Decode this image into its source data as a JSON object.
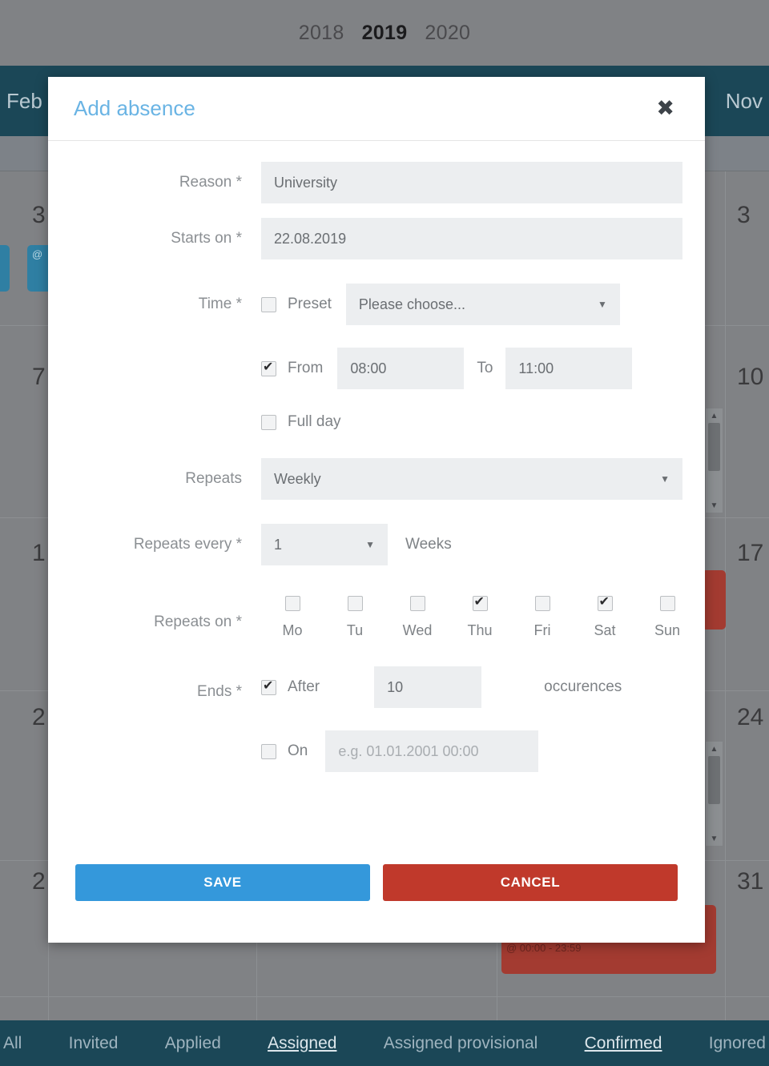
{
  "background": {
    "years": [
      {
        "label": "2018",
        "active": false
      },
      {
        "label": "2019",
        "active": true
      },
      {
        "label": "2020",
        "active": false
      }
    ],
    "month_nav": {
      "prev": "Feb",
      "next": "Nov"
    },
    "day_numbers_left": [
      "3",
      "7",
      "1",
      "2",
      "2"
    ],
    "day_numbers_right": [
      "3",
      "10",
      "17",
      "24",
      "31"
    ],
    "events": [
      {
        "label": "@",
        "color": "blue"
      },
      {
        "label": "@ 00:00 - 23:59",
        "color": "red"
      }
    ],
    "legend": [
      {
        "label": "All",
        "underline": false
      },
      {
        "label": "Invited",
        "underline": false
      },
      {
        "label": "Applied",
        "underline": false
      },
      {
        "label": "Assigned",
        "underline": true
      },
      {
        "label": "Assigned provisional",
        "underline": false
      },
      {
        "label": "Confirmed",
        "underline": true
      },
      {
        "label": "Ignored",
        "underline": false
      }
    ],
    "colors": {
      "navbar": "#1b4757",
      "overlay": "#808285",
      "blue_event": "#2f7fa3",
      "red_event": "#a33b31"
    }
  },
  "dialog": {
    "title": "Add absence",
    "close_label": "✖",
    "reason": {
      "label": "Reason *",
      "value": "University"
    },
    "starts_on": {
      "label": "Starts on *",
      "value": "22.08.2019"
    },
    "time": {
      "label": "Time *",
      "preset": {
        "checked": false,
        "label": "Preset",
        "value": "Please choose...",
        "caret": "▼"
      },
      "from": {
        "checked": true,
        "label": "From",
        "value": "08:00"
      },
      "to": {
        "label": "To",
        "value": "11:00"
      },
      "full_day": {
        "checked": false,
        "label": "Full day"
      }
    },
    "repeats": {
      "label": "Repeats",
      "value": "Weekly",
      "caret": "▼"
    },
    "repeats_every": {
      "label": "Repeats every *",
      "value": "1",
      "caret": "▼",
      "unit": "Weeks"
    },
    "repeats_on": {
      "label": "Repeats on *",
      "days": [
        {
          "label": "Mo",
          "checked": false
        },
        {
          "label": "Tu",
          "checked": false
        },
        {
          "label": "Wed",
          "checked": false
        },
        {
          "label": "Thu",
          "checked": true
        },
        {
          "label": "Fri",
          "checked": false
        },
        {
          "label": "Sat",
          "checked": true
        },
        {
          "label": "Sun",
          "checked": false
        }
      ]
    },
    "ends": {
      "label": "Ends *",
      "after": {
        "checked": true,
        "label": "After",
        "value": "10",
        "unit": "occurences"
      },
      "on": {
        "checked": false,
        "label": "On",
        "placeholder": "e.g. 01.01.2001 00:00",
        "value": ""
      }
    },
    "buttons": {
      "save": "SAVE",
      "cancel": "CANCEL"
    },
    "colors": {
      "title": "#6ab4e4",
      "save": "#3498db",
      "cancel": "#c0392b"
    }
  }
}
